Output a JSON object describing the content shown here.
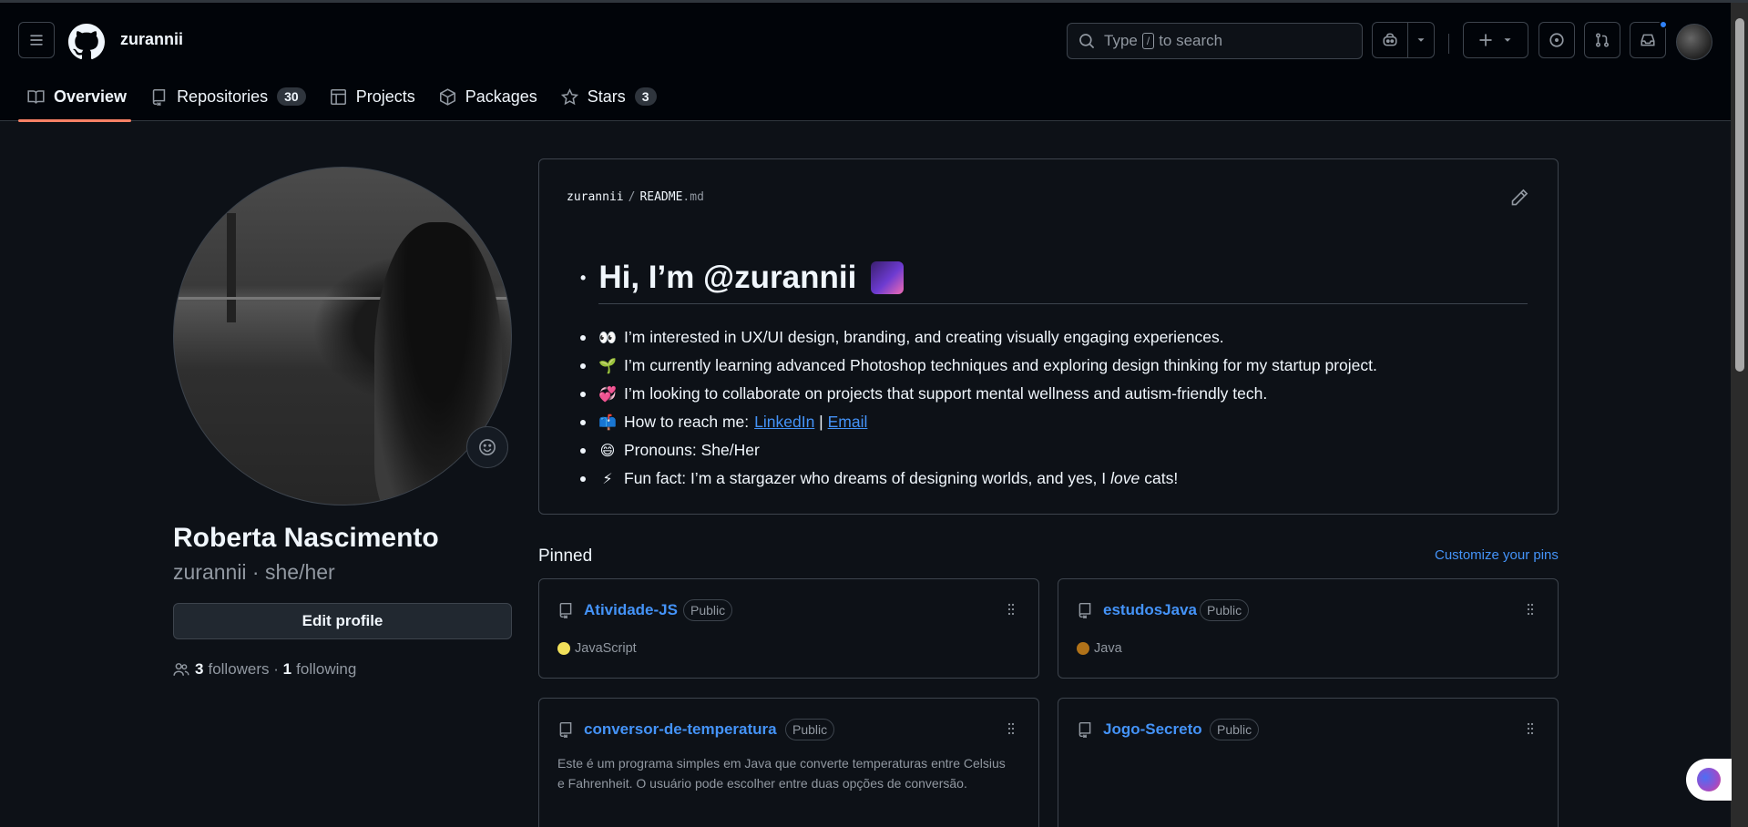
{
  "header": {
    "owner": "zurannii",
    "search_prefix": "Type",
    "search_key": "/",
    "search_suffix": "to search"
  },
  "tabs": [
    {
      "label": "Overview",
      "icon": "book-icon"
    },
    {
      "label": "Repositories",
      "icon": "repo-icon",
      "count": "30"
    },
    {
      "label": "Projects",
      "icon": "table-icon"
    },
    {
      "label": "Packages",
      "icon": "package-icon"
    },
    {
      "label": "Stars",
      "icon": "star-icon",
      "count": "3"
    }
  ],
  "profile": {
    "full_name": "Roberta Nascimento",
    "username_line": "zurannii · she/her",
    "edit_label": "Edit profile",
    "followers_count": "3",
    "followers_label": "followers",
    "dot": " · ",
    "following_count": "1",
    "following_label": "following"
  },
  "readme": {
    "path_owner": "zurannii",
    "path_sep": "/",
    "path_file": "README",
    "path_ext": ".md",
    "heading": "Hi, I’m @zurannii",
    "items": [
      {
        "emoji": "👀",
        "text": "I’m interested in UX/UI design, branding, and creating visually engaging experiences."
      },
      {
        "emoji": "🌱",
        "text": "I’m currently learning advanced Photoshop techniques and exploring design thinking for my startup project."
      },
      {
        "emoji": "💞️",
        "text": "I’m looking to collaborate on projects that support mental wellness and autism-friendly tech."
      },
      {
        "emoji": "📫",
        "text": "How to reach me:",
        "link1": "LinkedIn",
        "sep": " | ",
        "link2": "Email"
      },
      {
        "emoji": "😄",
        "text": "Pronouns: She/Her"
      },
      {
        "emoji": "⚡",
        "text_before": "Fun fact: I’m a stargazer who dreams of designing worlds, and yes, I",
        "em": "love",
        "text_after": "cats!"
      }
    ]
  },
  "pinned": {
    "title": "Pinned",
    "customize": "Customize your pins",
    "repos": [
      {
        "name": "Atividade-JS",
        "visibility": "Public",
        "language": "JavaScript",
        "lang_color": "#f1e05a"
      },
      {
        "name": "estudosJava",
        "visibility": "Public",
        "language": "Java",
        "lang_color": "#b07219"
      },
      {
        "name": "conversor-de-temperatura",
        "visibility": "Public",
        "description": "Este é um programa simples em Java que converte temperaturas entre Celsius e Fahrenheit. O usuário pode escolher entre duas opções de conversão."
      },
      {
        "name": "Jogo-Secreto",
        "visibility": "Public"
      }
    ]
  },
  "colors": {
    "accent": "#f78166",
    "link": "#4493f8",
    "bg": "#0d1117"
  }
}
